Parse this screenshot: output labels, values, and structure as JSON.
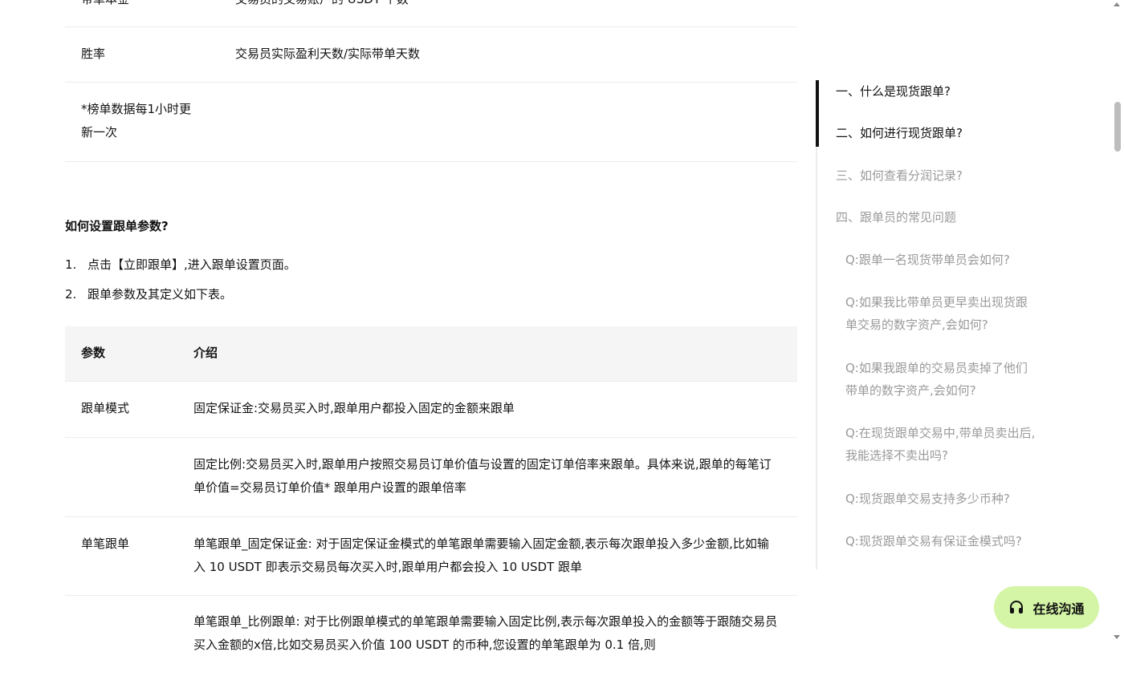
{
  "table1": {
    "rows": [
      {
        "name": "带单本金",
        "desc": "交易员的交易账户的 USDT 个数"
      },
      {
        "name": "胜率",
        "desc": "交易员实际盈利天数/实际带单天数"
      },
      {
        "name": "*榜单数据每1小时更新一次",
        "desc": ""
      }
    ]
  },
  "section": {
    "heading": "如何设置跟单参数?",
    "steps": [
      {
        "num": "1.",
        "text": "点击【立即跟单】,进入跟单设置页面。"
      },
      {
        "num": "2.",
        "text": "跟单参数及其定义如下表。"
      }
    ]
  },
  "table2": {
    "headers": [
      "参数",
      "介绍"
    ],
    "rows": [
      {
        "name": "跟单模式",
        "desc": "固定保证金:交易员买入时,跟单用户都投入固定的金额来跟单"
      },
      {
        "name": "",
        "desc": "固定比例:交易员买入时,跟单用户按照交易员订单价值与设置的固定订单倍率来跟单。具体来说,跟单的每笔订单价值=交易员订单价值* 跟单用户设置的跟单倍率"
      },
      {
        "name": "单笔跟单",
        "desc": "单笔跟单_固定保证金: 对于固定保证金模式的单笔跟单需要输入固定金额,表示每次跟单投入多少金额,比如输入 10 USDT 即表示交易员每次买入时,跟单用户都会投入 10 USDT 跟单"
      },
      {
        "name": "",
        "desc": "单笔跟单_比例跟单: 对于比例跟单模式的单笔跟单需要输入固定比例,表示每次跟单投入的金额等于跟随交易员买入金额的x倍,比如交易员买入价值 100 USDT 的币种,您设置的单笔跟单为 0.1 倍,则"
      }
    ]
  },
  "toc": {
    "items": [
      {
        "text": "一、什么是现货跟单?",
        "active": true
      },
      {
        "text": "二、如何进行现货跟单?",
        "active": true
      },
      {
        "text": "三、如何查看分润记录?",
        "active": false
      },
      {
        "text": "四、跟单员的常见问题",
        "active": false
      },
      {
        "text": "Q:跟单一名现货带单员会如何?",
        "active": false
      },
      {
        "text": "Q:如果我比带单员更早卖出现货跟单交易的数字资产,会如何?",
        "active": false
      },
      {
        "text": "Q:如果我跟单的交易员卖掉了他们带单的数字资产,会如何?",
        "active": false
      },
      {
        "text": "Q:在现货跟单交易中,带单员卖出后,我能选择不卖出吗?",
        "active": false
      },
      {
        "text": "Q:现货跟单交易支持多少币种?",
        "active": false
      },
      {
        "text": "Q:现货跟单交易有保证金模式吗?",
        "active": false
      }
    ]
  },
  "chat": {
    "label": "在线沟通"
  },
  "colors": {
    "chat_bg": "#d4f5a6",
    "toc_inactive": "#9a9a9a",
    "text": "#121212"
  }
}
